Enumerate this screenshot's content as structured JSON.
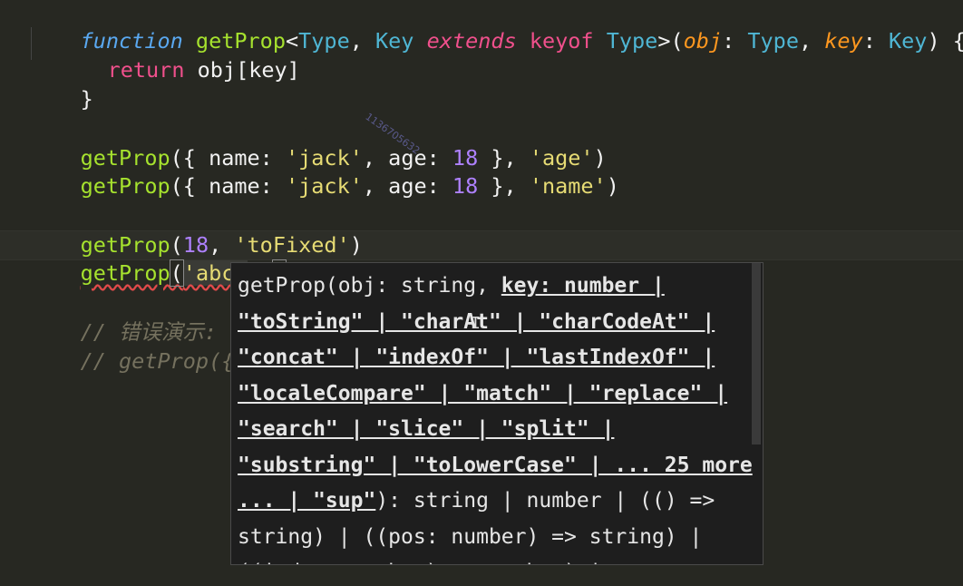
{
  "editor": {
    "lines": {
      "l1": {
        "kw_function": "function",
        "name": " getProp",
        "lt": "<",
        "type1": "Type",
        "comma1": ", ",
        "type2": "Key",
        "sp1": " ",
        "kw_extends": "extends",
        "sp2": " ",
        "kw_keyof": "keyof",
        "sp3": " ",
        "type3": "Type",
        "gt": ">(",
        "p_obj": "obj",
        "colon1": ": ",
        "type4": "Type",
        "comma2": ", ",
        "p_key": "key",
        "colon2": ": ",
        "type5": "Key",
        "close": ") {"
      },
      "l2": {
        "kw_return": "return",
        "rest": " obj[key]"
      },
      "l3": {
        "text": "}"
      },
      "l4": {
        "fn": "getProp",
        "a": "({ name: ",
        "s1": "'jack'",
        "b": ", age: ",
        "n": "18",
        "c": " }, ",
        "s2": "'age'",
        "d": ")"
      },
      "l5": {
        "fn": "getProp",
        "a": "({ name: ",
        "s1": "'jack'",
        "b": ", age: ",
        "n": "18",
        "c": " }, ",
        "s2": "'name'",
        "d": ")"
      },
      "l6": {
        "fn": "getProp",
        "a": "(",
        "n": "18",
        "b": ", ",
        "s": "'toFixed'",
        "c": ")"
      },
      "l7": {
        "fn": "getProp",
        "a": "(",
        "s": "'abc'",
        "b": ", ",
        "c": ")"
      },
      "l8": {
        "text": "// 错误演示:"
      },
      "l9": {
        "text": "// getProp({ na"
      }
    }
  },
  "tooltip": {
    "prefix": "getProp(obj: string, ",
    "active_param": "key: number | \"toString\" | \"charAt\" | \"charCodeAt\" | \"concat\" | \"indexOf\" | \"lastIndexOf\" | \"localeCompare\" | \"match\" | \"replace\" | \"search\" | \"slice\" | \"split\" | \"substring\" | \"toLowerCase\" | ... 25 more ... | \"sup\"",
    "suffix": "): string | number | (() => string) | ((pos: number) => string) | ((index: number) => number) |"
  },
  "watermark": "1136705632"
}
